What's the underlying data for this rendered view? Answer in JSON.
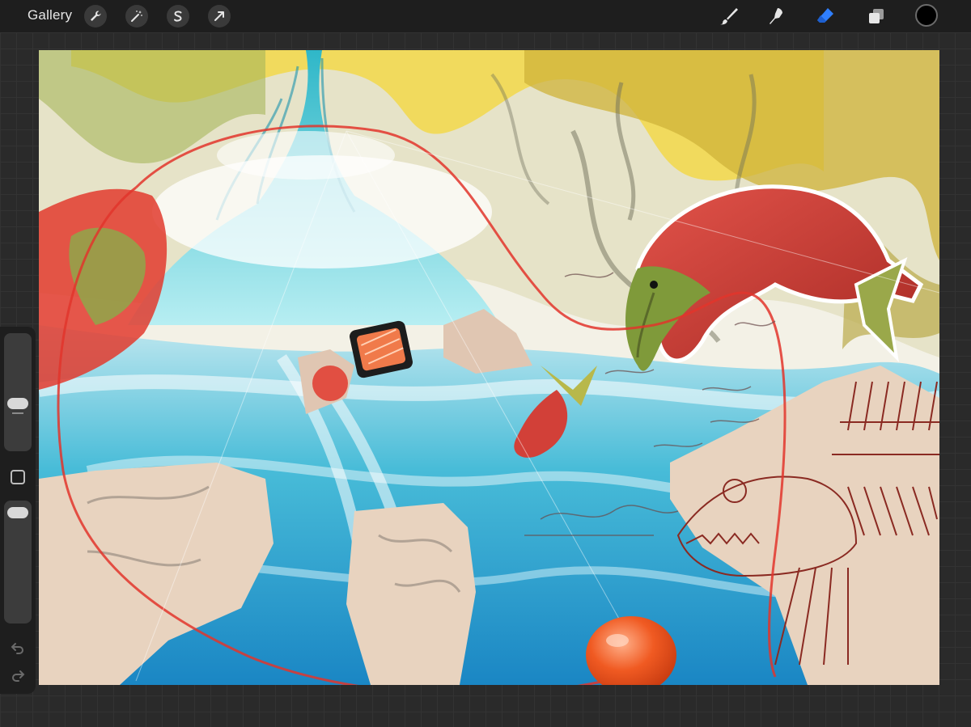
{
  "topbar": {
    "gallery_label": "Gallery",
    "left_tools": [
      {
        "name": "actions",
        "icon": "wrench-icon"
      },
      {
        "name": "adjustments",
        "icon": "magic-wand-icon"
      },
      {
        "name": "selection",
        "icon": "selection-s-icon"
      },
      {
        "name": "transform",
        "icon": "arrow-cursor-icon"
      }
    ],
    "right_tools": [
      {
        "name": "brush",
        "icon": "brush-icon",
        "active": false
      },
      {
        "name": "smudge",
        "icon": "smudge-icon",
        "active": false
      },
      {
        "name": "eraser",
        "icon": "eraser-icon",
        "active": true
      },
      {
        "name": "layers",
        "icon": "layers-icon",
        "active": false
      }
    ],
    "current_color": "#000000"
  },
  "sidebar": {
    "brush_size_level": 0.3,
    "opacity_level": 0.05,
    "modify_button_icon": "square-icon",
    "undo_icon": "undo-icon",
    "redo_icon": "redo-icon"
  },
  "colors": {
    "toolbar_bg": "#1e1e1e",
    "accent_eraser": "#2f7fff",
    "water": "#2aa6d6",
    "salmon_red": "#d83a2e",
    "rock_beige": "#e8d3bf",
    "foliage_yellow": "#e2c22c"
  }
}
